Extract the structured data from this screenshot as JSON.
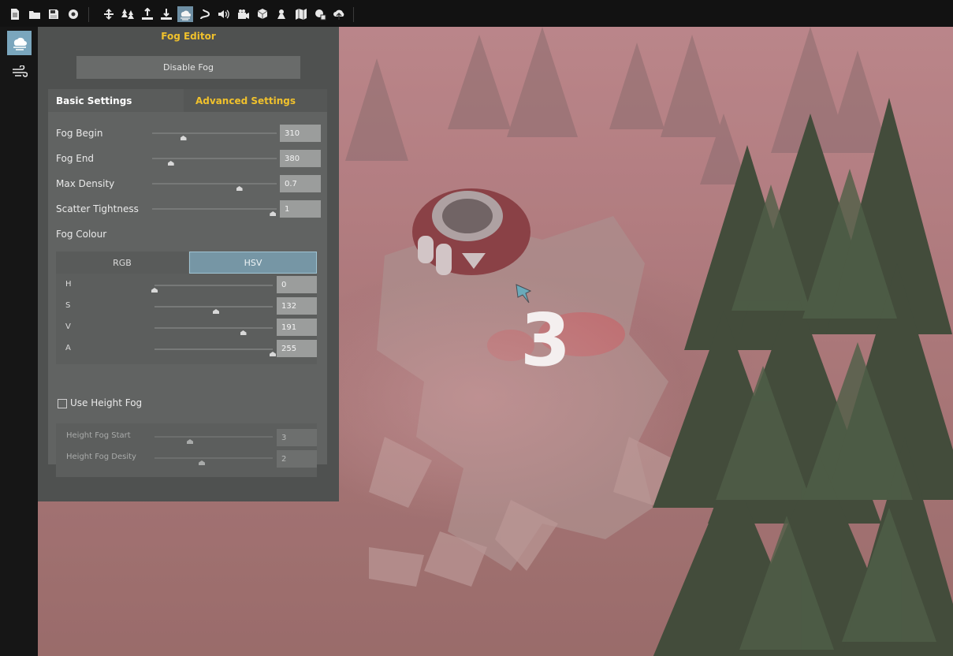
{
  "toolbar": {
    "icons": [
      "new-file-icon",
      "open-folder-icon",
      "save-icon",
      "settings-gear-icon",
      "terrain-flatten-icon",
      "forest-icon",
      "terrain-raise-icon",
      "terrain-lower-icon",
      "fog-icon",
      "path-icon",
      "audio-icon",
      "camera-icon",
      "props-icon",
      "lighting-icon",
      "map-icon",
      "plugin-icon",
      "upload-icon"
    ],
    "active_icon": "fog-icon"
  },
  "side_tabs": [
    {
      "name": "fog-tab",
      "icon": "fog-icon",
      "active": true
    },
    {
      "name": "wind-tab",
      "icon": "wind-icon",
      "active": false
    }
  ],
  "panel": {
    "title": "Fog Editor",
    "disable_button": "Disable Fog",
    "tabs": {
      "basic": "Basic Settings",
      "advanced": "Advanced Settings"
    },
    "settings": [
      {
        "label": "Fog Begin",
        "value": "310",
        "level": 0.25
      },
      {
        "label": "Fog End",
        "value": "380",
        "level": 0.15
      },
      {
        "label": "Max Density",
        "value": "0.7",
        "level": 0.7
      },
      {
        "label": "Scatter Tightness",
        "value": "1",
        "level": 0.97
      }
    ],
    "fog_colour_label": "Fog Colour",
    "colour_tabs": {
      "rgb": "RGB",
      "hsv": "HSV",
      "active": "HSV"
    },
    "hsv": [
      {
        "label": "H",
        "value": "0",
        "level": 0.0
      },
      {
        "label": "S",
        "value": "132",
        "level": 0.52
      },
      {
        "label": "V",
        "value": "191",
        "level": 0.75
      },
      {
        "label": "A",
        "value": "255",
        "level": 1.0
      }
    ],
    "height_fog": {
      "label": "Use Height Fog",
      "checked": false,
      "rows": [
        {
          "label": "Height Fog Start",
          "value": "3",
          "level": 0.3
        },
        {
          "label": "Height Fog Desity",
          "value": "2",
          "level": 0.4
        }
      ]
    }
  },
  "viewport": {
    "marker_number": "3"
  },
  "colors": {
    "title_accent": "#f0c12c",
    "active_tab": "#7696a5",
    "toolbar_bg": "#121212",
    "panel_bg": "#4f5150"
  }
}
